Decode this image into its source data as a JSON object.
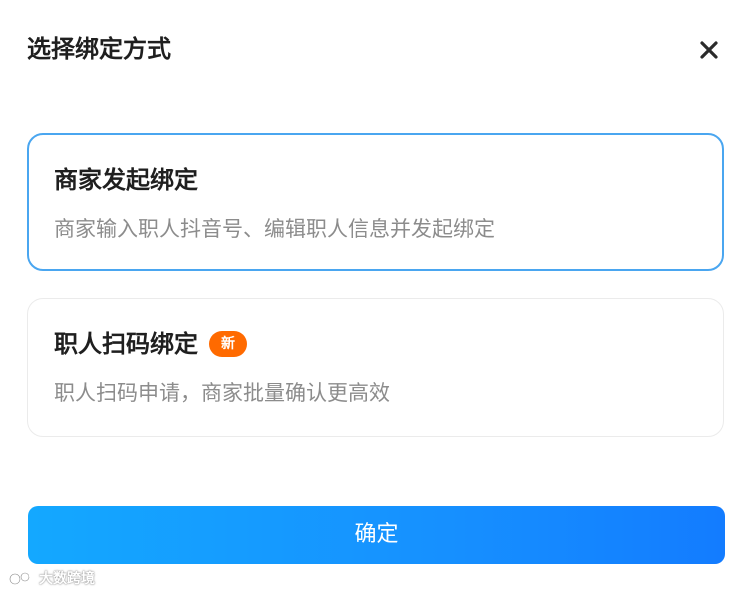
{
  "dialog": {
    "title": "选择绑定方式"
  },
  "options": [
    {
      "title": "商家发起绑定",
      "description": "商家输入职人抖音号、编辑职人信息并发起绑定",
      "selected": true
    },
    {
      "title": "职人扫码绑定",
      "badge": "新",
      "description": "职人扫码申请，商家批量确认更高效",
      "selected": false
    }
  ],
  "confirm_button": {
    "label": "确定"
  },
  "watermark": {
    "text": "大数跨境"
  },
  "icons": {
    "close": "close-icon",
    "watermark_logo": "watermark-logo-icon"
  },
  "colors": {
    "accent": "#1690ff",
    "selected_border": "#4aa6f0",
    "badge": "#ff6a00",
    "description": "#8c8c8c",
    "title": "#1f1f1f"
  }
}
